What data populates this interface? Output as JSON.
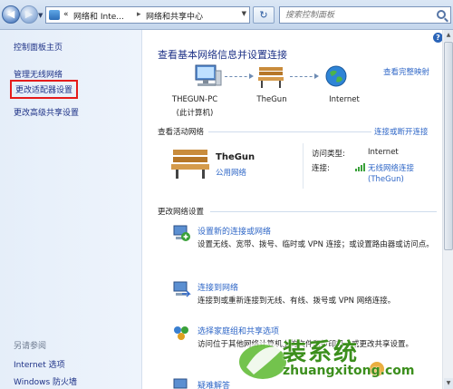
{
  "address_bar": {
    "prefix": "«",
    "crumb1": "网络和 Inte...",
    "crumb2": "网络和共享中心",
    "search_placeholder": "搜索控制面板"
  },
  "sidebar": {
    "home": "控制面板主页",
    "items": [
      "管理无线网络",
      "更改适配器设置",
      "更改高级共享设置"
    ],
    "see_also_heading": "另请参阅",
    "see_also": [
      "Internet 选项",
      "Windows 防火墙"
    ]
  },
  "main": {
    "title": "查看基本网络信息并设置连接",
    "full_map_link": "查看完整映射",
    "map": {
      "computer_name": "THEGUN-PC",
      "computer_sub": "(此计算机)",
      "network_name": "TheGun",
      "internet_name": "Internet"
    },
    "active_heading": "查看活动网络",
    "connect_disconnect_link": "连接或断开连接",
    "active_network": {
      "name": "TheGun",
      "type": "公用网络",
      "access_type_label": "访问类型:",
      "access_type_value": "Internet",
      "connections_label": "连接:",
      "connection_name": "无线网络连接",
      "connection_ssid": "(TheGun)"
    },
    "change_heading": "更改网络设置",
    "tasks": [
      {
        "title": "设置新的连接或网络",
        "desc": "设置无线、宽带、拨号、临时或 VPN 连接；或设置路由器或访问点。"
      },
      {
        "title": "连接到网络",
        "desc": "连接到或重新连接到无线、有线、拨号或 VPN 网络连接。"
      },
      {
        "title": "选择家庭组和共享选项",
        "desc": "访问位于其他网络计算机上的文件和打印机，或更改共享设置。"
      },
      {
        "title": "疑难解答",
        "desc": ""
      }
    ]
  },
  "watermark": {
    "brand": "装系统",
    "site": "zhuangxitong.com"
  },
  "colors": {
    "link": "#2f67c7",
    "highlight_box": "#e51b1b",
    "watermark": "#3c8f1d"
  }
}
